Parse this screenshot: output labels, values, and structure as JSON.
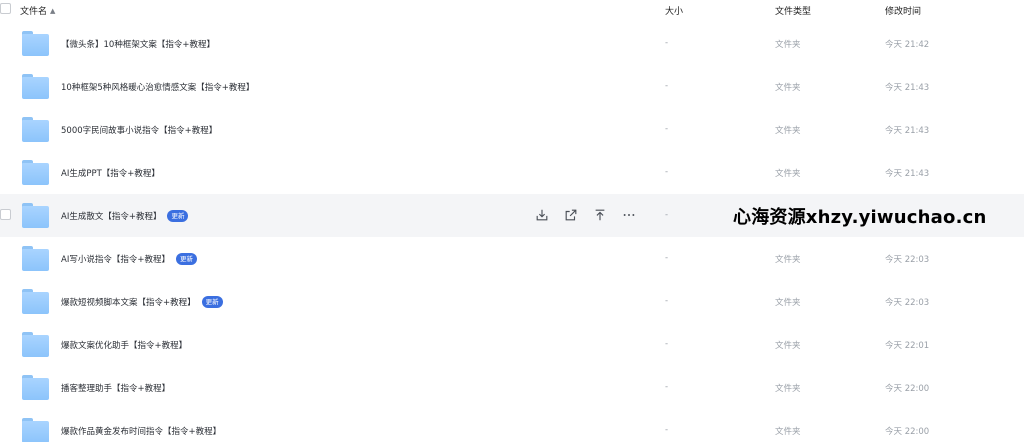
{
  "header": {
    "name_label": "文件名",
    "size_label": "大小",
    "type_label": "文件类型",
    "time_label": "修改时间"
  },
  "rows": [
    {
      "name": "【微头条】10种框架文案【指令+教程】",
      "size": "-",
      "type": "文件夹",
      "time": "今天 21:42",
      "badge": ""
    },
    {
      "name": "10种框架5种风格暖心治愈情感文案【指令+教程】",
      "size": "-",
      "type": "文件夹",
      "time": "今天 21:43",
      "badge": ""
    },
    {
      "name": "5000字民间故事小说指令【指令+教程】",
      "size": "-",
      "type": "文件夹",
      "time": "今天 21:43",
      "badge": ""
    },
    {
      "name": "AI生成PPT【指令+教程】",
      "size": "-",
      "type": "文件夹",
      "time": "今天 21:43",
      "badge": ""
    },
    {
      "name": "AI生成散文【指令+教程】",
      "size": "-",
      "type": "",
      "time": "",
      "badge": "更新"
    },
    {
      "name": "AI写小说指令【指令+教程】",
      "size": "-",
      "type": "文件夹",
      "time": "今天 22:03",
      "badge": "更新"
    },
    {
      "name": "爆款短视频脚本文案【指令+教程】",
      "size": "-",
      "type": "文件夹",
      "time": "今天 22:03",
      "badge": "更新"
    },
    {
      "name": "爆款文案优化助手【指令+教程】",
      "size": "-",
      "type": "文件夹",
      "time": "今天 22:01",
      "badge": ""
    },
    {
      "name": "播客整理助手【指令+教程】",
      "size": "-",
      "type": "文件夹",
      "time": "今天 22:00",
      "badge": ""
    },
    {
      "name": "爆款作品黄金发布时间指令【指令+教程】",
      "size": "-",
      "type": "文件夹",
      "time": "今天 22:00",
      "badge": ""
    }
  ],
  "hover_row_index": 4,
  "row_actions": [
    "download-icon",
    "share-icon",
    "move-to-top-icon",
    "more-icon"
  ],
  "watermark": "心海资源xhzy.yiwuchao.cn",
  "colors": {
    "badge": "#3b6fe0",
    "hover": "#f4f5f7",
    "folder": "#a9d4ff"
  }
}
